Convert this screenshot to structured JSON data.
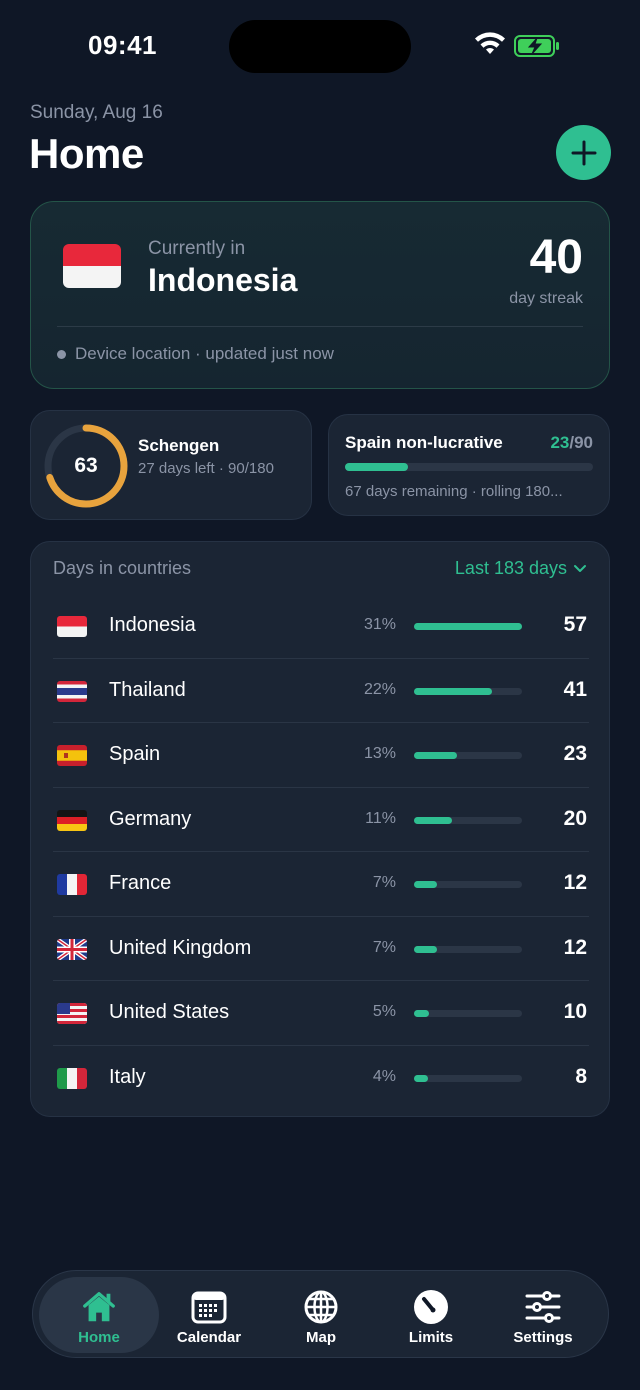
{
  "status_bar": {
    "time": "09:41"
  },
  "header": {
    "date": "Sunday, Aug 16",
    "title": "Home"
  },
  "current": {
    "label": "Currently in",
    "country": "Indonesia",
    "streak": "40",
    "streak_label": "day streak",
    "location_text": "Device location · updated just now"
  },
  "schengen": {
    "value": "63",
    "title": "Schengen",
    "subtitle": "27 days left · 90/180",
    "ring_fraction": 0.7,
    "ring_color": "#e8a33d"
  },
  "spain": {
    "title": "Spain non-lucrative",
    "used": "23",
    "total": "/90",
    "progress": 0.2556,
    "subtitle": "67 days remaining · rolling 180..."
  },
  "days": {
    "title": "Days in countries",
    "range": "Last 183 days",
    "rows": [
      {
        "flag": "id",
        "name": "Indonesia",
        "pct": "31%",
        "fraction": 1.0,
        "days": "57"
      },
      {
        "flag": "th",
        "name": "Thailand",
        "pct": "22%",
        "fraction": 0.72,
        "days": "41"
      },
      {
        "flag": "es",
        "name": "Spain",
        "pct": "13%",
        "fraction": 0.4,
        "days": "23"
      },
      {
        "flag": "de",
        "name": "Germany",
        "pct": "11%",
        "fraction": 0.35,
        "days": "20"
      },
      {
        "flag": "fr",
        "name": "France",
        "pct": "7%",
        "fraction": 0.21,
        "days": "12"
      },
      {
        "flag": "gb",
        "name": "United Kingdom",
        "pct": "7%",
        "fraction": 0.21,
        "days": "12"
      },
      {
        "flag": "us",
        "name": "United States",
        "pct": "5%",
        "fraction": 0.14,
        "days": "10"
      },
      {
        "flag": "it",
        "name": "Italy",
        "pct": "4%",
        "fraction": 0.13,
        "days": "8"
      }
    ]
  },
  "tabs": [
    {
      "label": "Home",
      "icon": "home-icon",
      "active": true
    },
    {
      "label": "Calendar",
      "icon": "calendar-icon",
      "active": false
    },
    {
      "label": "Map",
      "icon": "globe-icon",
      "active": false
    },
    {
      "label": "Limits",
      "icon": "gauge-icon",
      "active": false
    },
    {
      "label": "Settings",
      "icon": "sliders-icon",
      "active": false
    }
  ],
  "colors": {
    "accent": "#2fbf91",
    "background": "#0f1726",
    "card": "#1b2534",
    "warning": "#e8a33d"
  }
}
